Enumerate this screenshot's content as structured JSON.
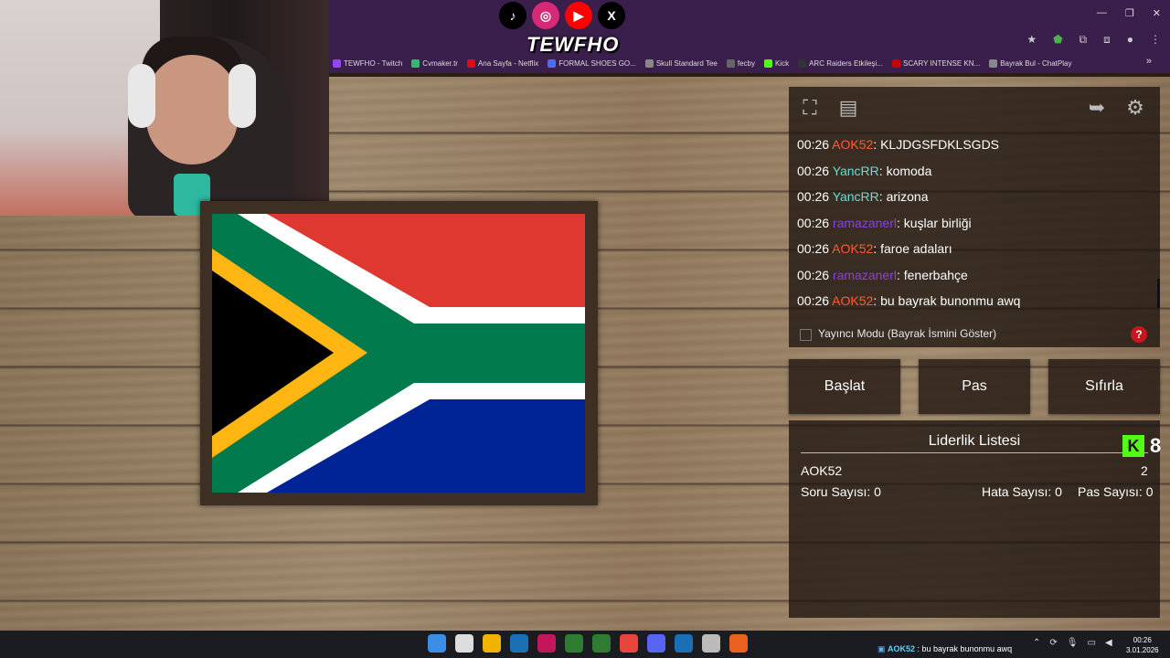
{
  "browser": {
    "bookmarks": [
      {
        "label": "TEWFHO - Twitch",
        "color": "#9146ff"
      },
      {
        "label": "Cvmaker.tr",
        "color": "#3cb371"
      },
      {
        "label": "Ana Sayfa - Netflix",
        "color": "#e50914"
      },
      {
        "label": "FORMAL SHOES GO...",
        "color": "#4a6cf7"
      },
      {
        "label": "Skull Standard Tee",
        "color": "#888888"
      },
      {
        "label": "fecby",
        "color": "#666666"
      },
      {
        "label": "Kick",
        "color": "#53fc18"
      },
      {
        "label": "ARC Raiders Etkileşi...",
        "color": "#333333"
      },
      {
        "label": "SCARY INTENSE KN...",
        "color": "#cc0000"
      },
      {
        "label": "Bayrak Bul - ChatPlay",
        "color": "#888888"
      }
    ],
    "window_controls": [
      "—",
      "❐",
      "✕"
    ],
    "more": "»"
  },
  "overlay": {
    "brand": "TEWFHO",
    "socials": [
      {
        "icon": "tiktok-icon",
        "glyph": "♪",
        "bg": "#000000"
      },
      {
        "icon": "instagram-icon",
        "glyph": "◎",
        "bg": "#d62976"
      },
      {
        "icon": "youtube-icon",
        "glyph": "▶",
        "bg": "#ff0000"
      },
      {
        "icon": "x-icon",
        "glyph": "X",
        "bg": "#000000"
      }
    ]
  },
  "chat": {
    "messages": [
      {
        "time": "00:26",
        "user": "AOK52",
        "user_color": "#ff5a36",
        "text": "KLJDGSFDKLSGDS"
      },
      {
        "time": "00:26",
        "user": "YancRR",
        "user_color": "#5fe0d2",
        "text": "komoda"
      },
      {
        "time": "00:26",
        "user": "YancRR",
        "user_color": "#5fe0d2",
        "text": "arizona"
      },
      {
        "time": "00:26",
        "user": "ramazanerl",
        "user_color": "#8a3ee8",
        "text": "kuşlar birliği"
      },
      {
        "time": "00:26",
        "user": "AOK52",
        "user_color": "#ff5a36",
        "text": "faroe adaları"
      },
      {
        "time": "00:26",
        "user": "ramazanerl",
        "user_color": "#8a3ee8",
        "text": "fenerbahçe"
      },
      {
        "time": "00:26",
        "user": "AOK52",
        "user_color": "#ff5a36",
        "text": "bu bayrak bunonmu awq"
      }
    ],
    "separator": ": "
  },
  "controls": {
    "streamer_mode_label": "Yayıncı Modu (Bayrak İsmini Göster)",
    "streamer_mode_checked": false,
    "help": "?",
    "start": "Başlat",
    "pass": "Pas",
    "reset": "Sıfırla"
  },
  "leaderboard": {
    "title": "Liderlik Listesi",
    "kick_glyph": "K",
    "kick_count": "8",
    "entries": [
      {
        "name": "AOK52",
        "score": "2"
      }
    ],
    "question_count": "Soru Sayısı: 0",
    "error_count": "Hata Sayısı: 0",
    "pass_count": "Pas Sayısı: 0"
  },
  "taskbar": {
    "chat_user": "AOK52",
    "chat_text": " : bu bayrak bunonmu awq",
    "time": "00:26",
    "date": "3.01.2026",
    "apps": [
      "#3a8ee6",
      "#dddddd",
      "#f0b400",
      "#1b6fb5",
      "#c2185b",
      "#2e7d32",
      "#2e7d32",
      "#e8453c",
      "#5865f2",
      "#1b6fb5",
      "#bbbbbb",
      "#e8611e"
    ]
  }
}
